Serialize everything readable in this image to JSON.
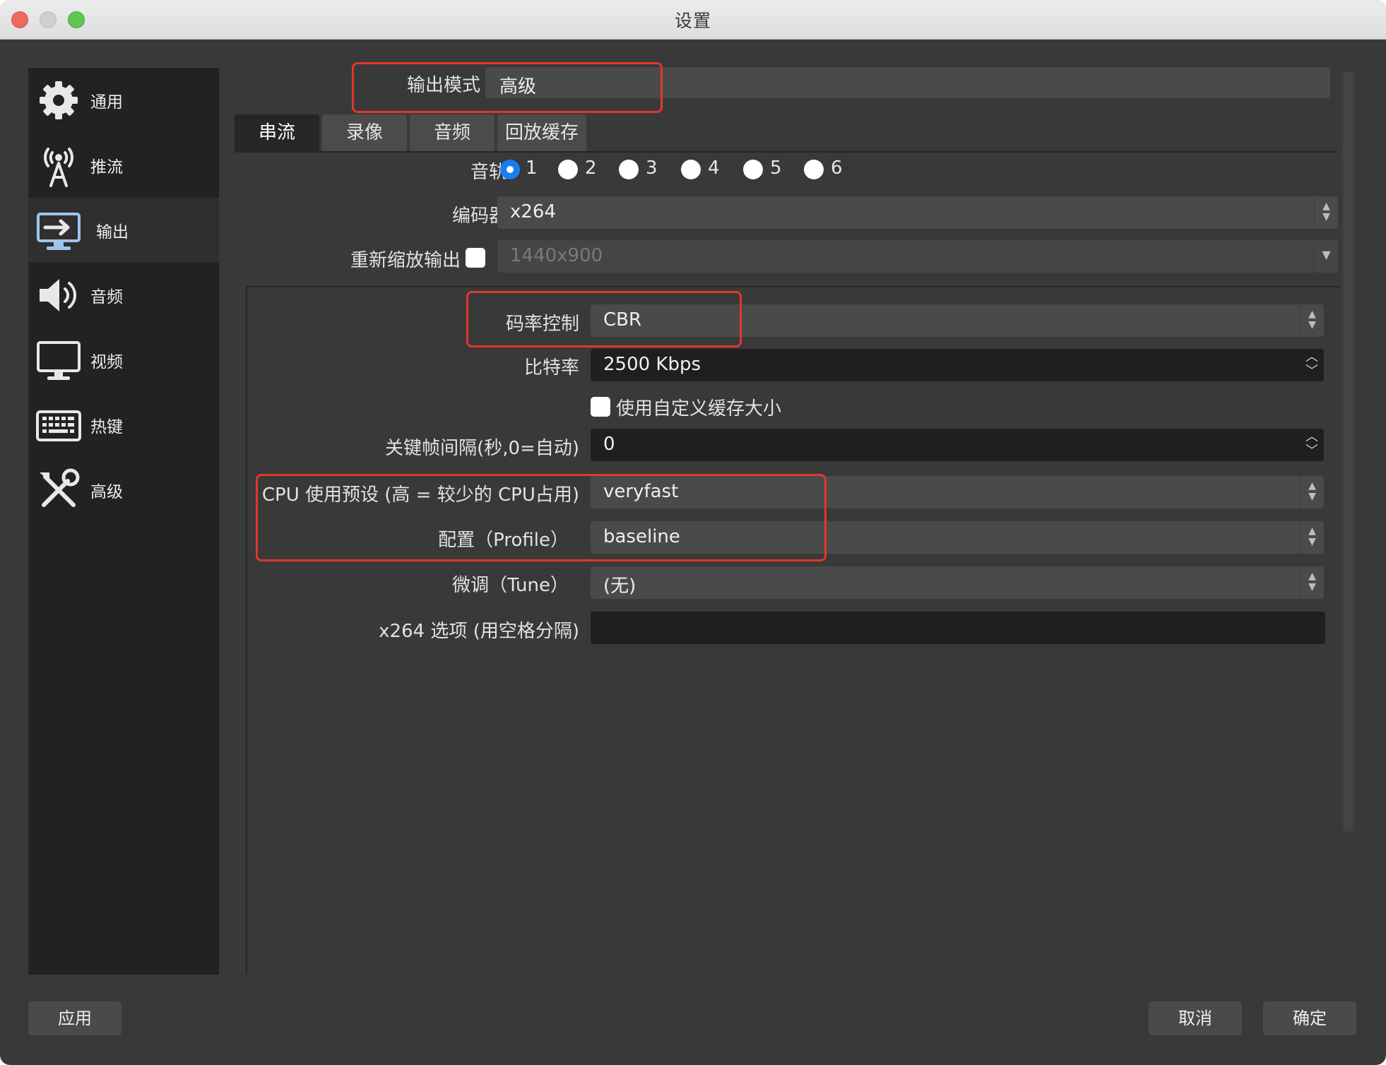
{
  "window": {
    "title": "设置"
  },
  "sidebar": {
    "items": [
      {
        "label": "通用",
        "icon": "gear-icon"
      },
      {
        "label": "推流",
        "icon": "antenna-icon"
      },
      {
        "label": "输出",
        "icon": "output-monitor-icon",
        "active": true
      },
      {
        "label": "音频",
        "icon": "speaker-icon"
      },
      {
        "label": "视频",
        "icon": "monitor-icon"
      },
      {
        "label": "热键",
        "icon": "keyboard-icon"
      },
      {
        "label": "高级",
        "icon": "tools-icon"
      }
    ]
  },
  "output_mode": {
    "label": "输出模式",
    "value": "高级"
  },
  "tabs": [
    {
      "label": "串流",
      "active": true
    },
    {
      "label": "录像"
    },
    {
      "label": "音频"
    },
    {
      "label": "回放缓存"
    }
  ],
  "audio_track": {
    "label": "音轨",
    "options": [
      "1",
      "2",
      "3",
      "4",
      "5",
      "6"
    ],
    "selected": "1"
  },
  "encoder": {
    "label": "编码器",
    "value": "x264"
  },
  "rescale": {
    "label": "重新缩放输出",
    "value": "1440x900",
    "checked": false
  },
  "rate_control": {
    "label": "码率控制",
    "value": "CBR"
  },
  "bitrate": {
    "label": "比特率",
    "value": "2500 Kbps"
  },
  "custom_buffer": {
    "label": "使用自定义缓存大小",
    "checked": false
  },
  "keyframe": {
    "label": "关键帧间隔(秒,0=自动)",
    "value": "0"
  },
  "cpu_preset": {
    "label": "CPU 使用预设 (高 = 较少的 CPU占用)",
    "value": "veryfast"
  },
  "profile": {
    "label": "配置（Profile）",
    "value": "baseline"
  },
  "tune": {
    "label": "微调（Tune）",
    "value": "(无)"
  },
  "x264_options": {
    "label": "x264 选项 (用空格分隔)",
    "value": ""
  },
  "buttons": {
    "apply": "应用",
    "cancel": "取消",
    "ok": "确定"
  },
  "colors": {
    "highlight": "#e0382b",
    "radio_selected": "#1a7cf5",
    "window_bg": "#393939"
  }
}
